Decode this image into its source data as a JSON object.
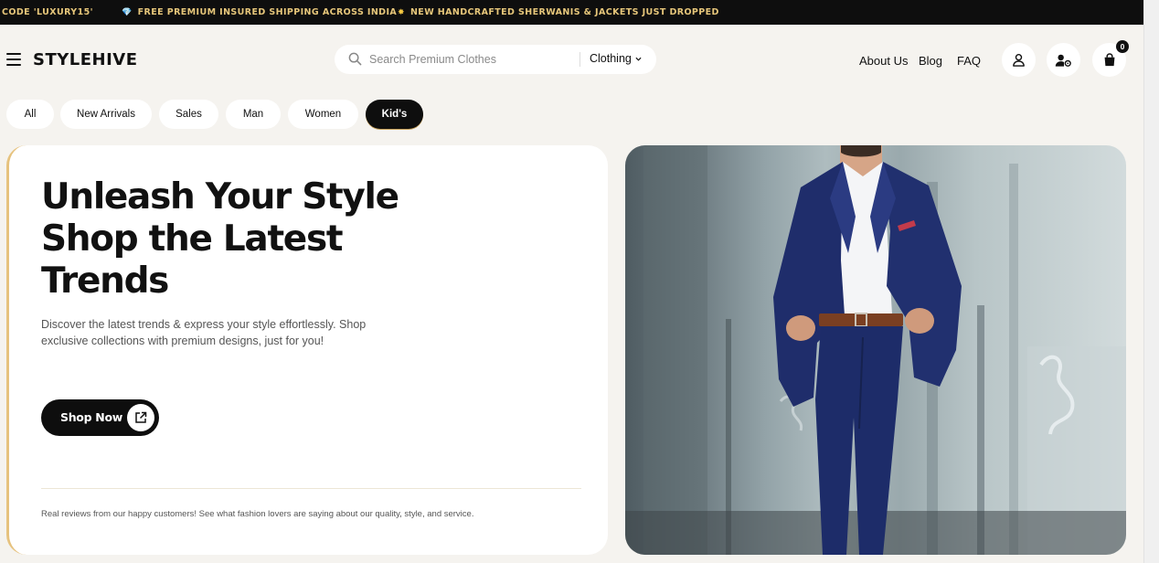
{
  "announcements": [
    {
      "glyph": "",
      "text": "CODE 'LUXURY15'"
    },
    {
      "glyph": "💎",
      "text": "FREE PREMIUM INSURED SHIPPING ACROSS INDIA"
    },
    {
      "glyph": "✸",
      "text": "NEW HANDCRAFTED SHERWANIS & JACKETS JUST DROPPED"
    }
  ],
  "header": {
    "brand": "STYLEHIVE",
    "search": {
      "placeholder": "Search Premium Clothes",
      "value": "",
      "category": "Clothing"
    },
    "nav": {
      "about": "About Us",
      "blog": "Blog",
      "faq": "FAQ"
    },
    "cart_count": "0"
  },
  "categories": {
    "all": "All",
    "new_arrivals": "New Arrivals",
    "sales": "Sales",
    "man": "Man",
    "women": "Women",
    "kids": "Kid's",
    "active": "Kid's"
  },
  "hero": {
    "title_line1": "Unleash Your Style",
    "title_line2": "Shop the Latest",
    "title_line3": "Trends",
    "description": "Discover the latest trends & express your style effortlessly. Shop exclusive collections with premium designs, just for you!",
    "cta_label": "Shop Now",
    "reviews_text": "Real reviews from our happy customers! See what fashion lovers are saying about our quality, style, and service."
  },
  "colors": {
    "accent_gold": "#e6c67a",
    "dark": "#0e0e0e",
    "page_bg": "#f5f3ef"
  },
  "icons": {
    "menu": "hamburger-menu-icon",
    "search": "search-icon",
    "chevron": "chevron-down-icon",
    "account": "user-icon",
    "user_settings": "user-settings-icon",
    "cart": "shopping-bag-icon",
    "cta": "external-link-icon"
  }
}
